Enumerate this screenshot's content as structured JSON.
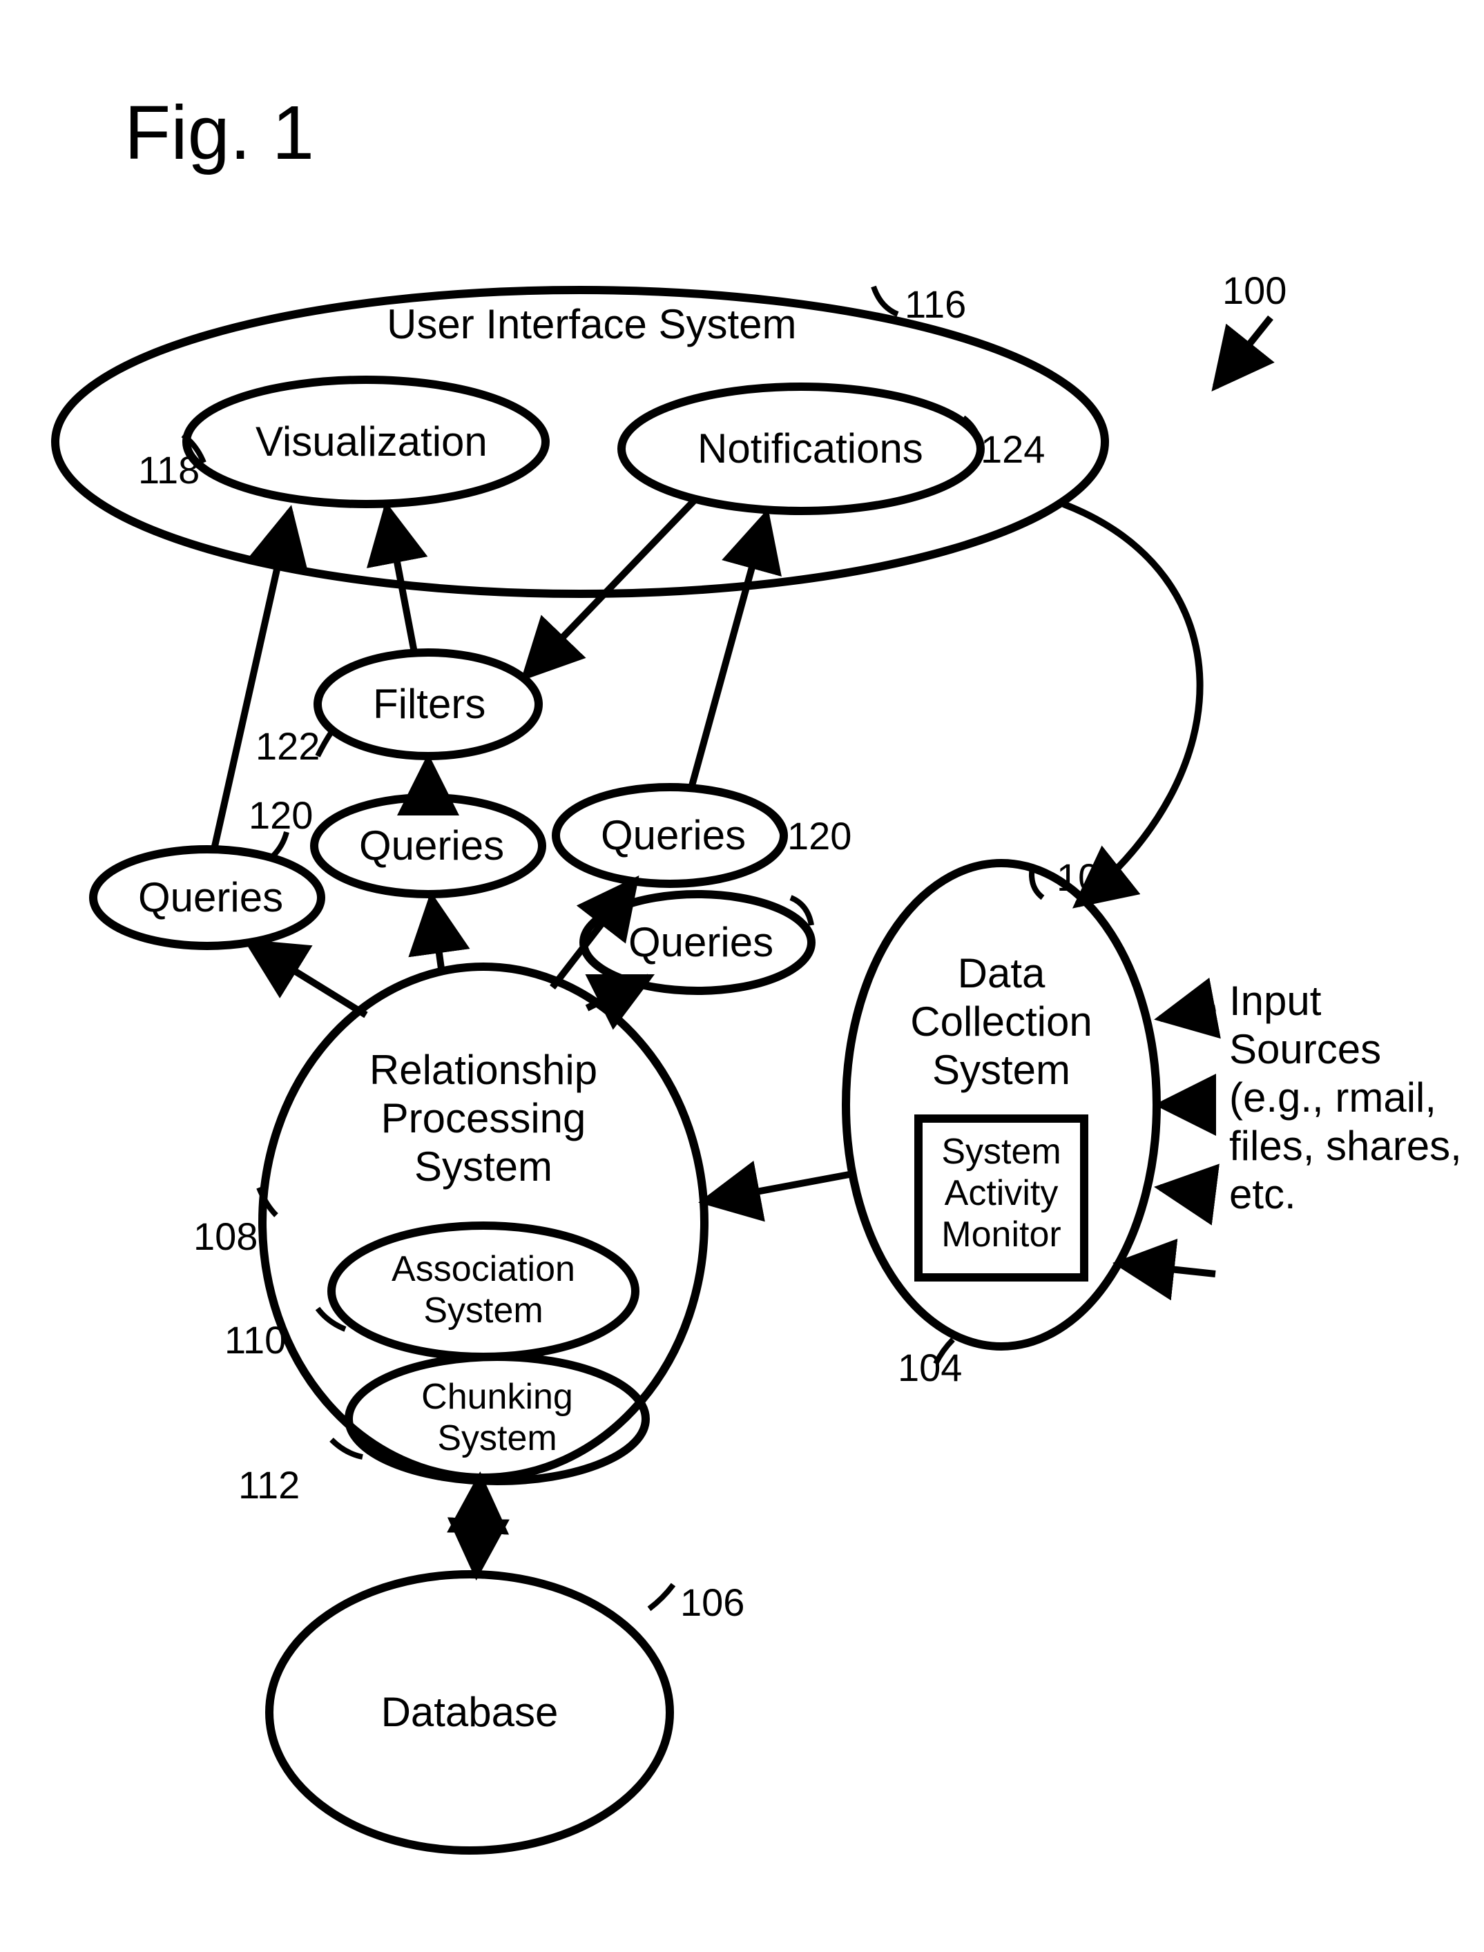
{
  "figure": {
    "title": "Fig. 1",
    "overall_ref": "100",
    "nodes": {
      "ui_system": {
        "label": "User Interface System",
        "ref": "116"
      },
      "visualization": {
        "label": "Visualization",
        "ref": "118"
      },
      "notifications": {
        "label": "Notifications",
        "ref": "124"
      },
      "filters": {
        "label": "Filters",
        "ref": "122"
      },
      "queries_a": {
        "label": "Queries",
        "ref": "120"
      },
      "queries_b": {
        "label": "Queries"
      },
      "queries_c": {
        "label": "Queries",
        "ref": "120"
      },
      "queries_d": {
        "label": "Queries"
      },
      "rps": {
        "label_line1": "Relationship",
        "label_line2": "Processing",
        "label_line3": "System",
        "ref": "108"
      },
      "association": {
        "label_line1": "Association",
        "label_line2": "System",
        "ref": "110"
      },
      "chunking": {
        "label_line1": "Chunking",
        "label_line2": "System",
        "ref": "112"
      },
      "database": {
        "label": "Database",
        "ref": "106"
      },
      "dcs": {
        "label_line1": "Data",
        "label_line2": "Collection",
        "label_line3": "System",
        "ref": "102"
      },
      "sam": {
        "label_line1": "System",
        "label_line2": "Activity",
        "label_line3": "Monitor",
        "ref": "104"
      },
      "input_sources": {
        "label_line1": "Input",
        "label_line2": "Sources",
        "label_line3": "(e.g., rmail,",
        "label_line4": "files, shares,",
        "label_line5": "etc."
      }
    }
  }
}
